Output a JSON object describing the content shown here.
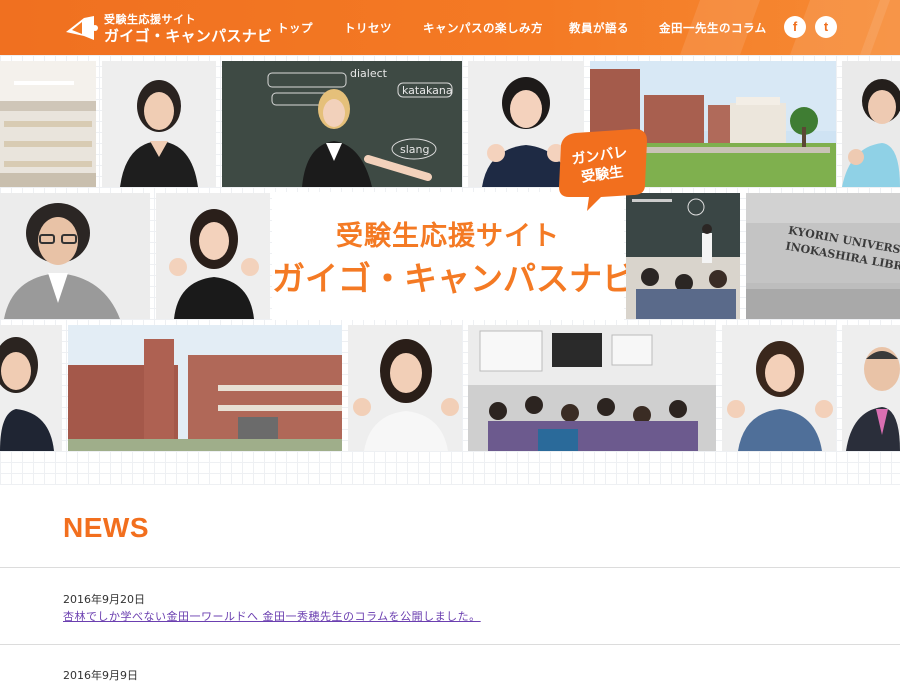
{
  "header": {
    "logo_sub": "受験生応援サイト",
    "logo_main": "ガイゴ・キャンパスナビ",
    "nav": [
      {
        "label": "トップ"
      },
      {
        "label": "トリセツ"
      },
      {
        "label": "キャンパスの楽しみ方"
      },
      {
        "label": "教員が語る"
      },
      {
        "label": "金田一先生のコラム"
      }
    ],
    "sns": {
      "facebook_icon": "f",
      "twitter_icon": "t"
    }
  },
  "hero": {
    "title_line1": "受験生応援サイト",
    "title_line2": "ガイゴ・キャンパスナビ",
    "badge_line1": "ガンバレ",
    "badge_line2": "受験生",
    "blackboard_words": [
      "dialect",
      "katakana",
      "slang"
    ],
    "sign_line1": "KYORIN UNIVERSI",
    "sign_line2": "INOKASHIRA LIBRA"
  },
  "news": {
    "title": "NEWS",
    "items": [
      {
        "date": "2016年9月20日",
        "text": "杏林でしか学べない金田一ワールドへ 金田一秀穂先生のコラムを公開しました。"
      },
      {
        "date": "2016年9月9日",
        "text": ""
      }
    ]
  },
  "colors": {
    "brand_orange": "#f47a24",
    "link_purple": "#6b3fb0"
  }
}
